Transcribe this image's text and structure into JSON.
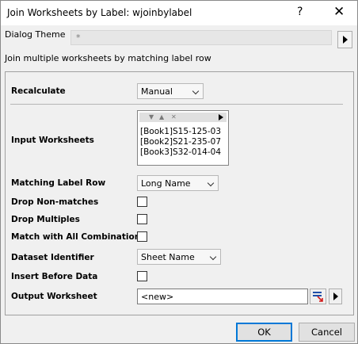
{
  "window": {
    "title": "Join Worksheets by Label: wjoinbylabel",
    "help_glyph": "?",
    "close_glyph": "✕"
  },
  "theme": {
    "label": "Dialog Theme",
    "value": "*"
  },
  "description": "Join multiple worksheets by matching label row",
  "form": {
    "recalculate": {
      "label": "Recalculate",
      "value": "Manual"
    },
    "input_worksheets": {
      "label": "Input Worksheets",
      "items": [
        "[Book1]S15-125-03",
        "[Book2]S21-235-07",
        "[Book3]S32-014-04"
      ]
    },
    "matching_label_row": {
      "label": "Matching Label Row",
      "value": "Long Name"
    },
    "drop_non_matches": {
      "label": "Drop Non-matches",
      "checked": false
    },
    "drop_multiples": {
      "label": "Drop Multiples",
      "checked": false
    },
    "match_all_combinations": {
      "label": "Match with All Combinations",
      "checked": false
    },
    "dataset_identifier": {
      "label": "Dataset Identifier",
      "value": "Sheet Name"
    },
    "insert_before_data": {
      "label": "Insert Before Data",
      "checked": false
    },
    "output_worksheet": {
      "label": "Output Worksheet",
      "value": "<new>"
    }
  },
  "buttons": {
    "ok": "OK",
    "cancel": "Cancel"
  },
  "colors": {
    "default_button_border": "#0078d7",
    "dialog_background": "#f0f0f0"
  }
}
